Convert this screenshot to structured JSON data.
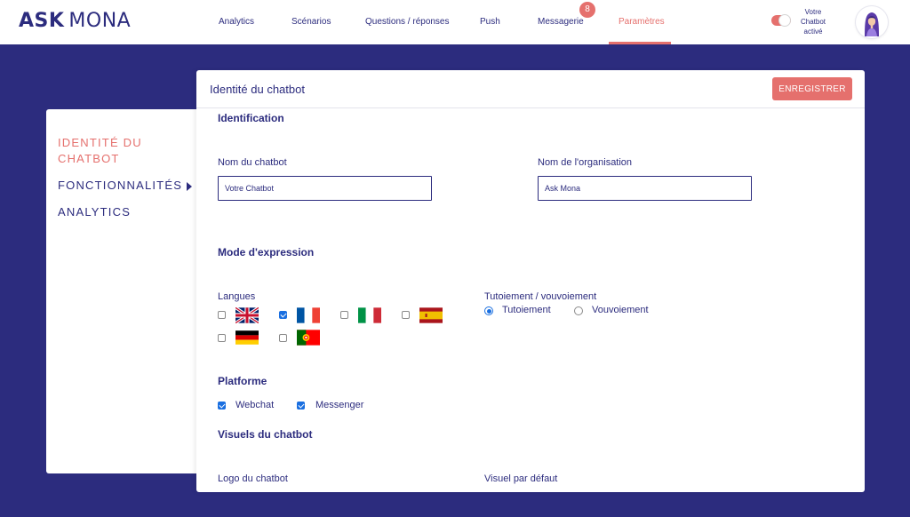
{
  "brand": {
    "logo_ask": "ASK",
    "logo_mona": "MONA"
  },
  "nav": {
    "items": [
      {
        "label": "Analytics"
      },
      {
        "label": "Scénarios"
      },
      {
        "label": "Questions / réponses"
      },
      {
        "label": "Push"
      },
      {
        "label": "Messagerie"
      },
      {
        "label": "Paramètres"
      }
    ],
    "active": "Paramètres",
    "messagerie_badge": "8"
  },
  "chatbot_status": {
    "line1": "Votre",
    "line2": "Chatbot",
    "line3": "activé",
    "enabled": true
  },
  "sidebar": {
    "items": [
      {
        "label": "IDENTITÉ DU CHATBOT"
      },
      {
        "label": "FONCTIONNALITÉS"
      },
      {
        "label": "ANALYTICS"
      }
    ]
  },
  "card": {
    "title": "Identité du chatbot",
    "save_label": "ENREGISTRER"
  },
  "identification": {
    "title": "Identification",
    "chatbot_name_label": "Nom du chatbot",
    "chatbot_name_value": "Votre Chatbot",
    "org_name_label": "Nom de l'organisation",
    "org_name_value": "Ask Mona"
  },
  "expression": {
    "title": "Mode d'expression",
    "languages_label": "Langues",
    "languages": [
      {
        "code": "en",
        "checked": false
      },
      {
        "code": "fr",
        "checked": true
      },
      {
        "code": "it",
        "checked": false
      },
      {
        "code": "es",
        "checked": false
      },
      {
        "code": "de",
        "checked": false
      },
      {
        "code": "pt",
        "checked": false
      }
    ],
    "address_label": "Tutoiement / vouvoiement",
    "tutoiement_label": "Tutoiement",
    "vouvoiement_label": "Vouvoiement",
    "selected": "Tutoiement"
  },
  "platform": {
    "title": "Platforme",
    "webchat_label": "Webchat",
    "webchat_checked": true,
    "messenger_label": "Messenger",
    "messenger_checked": true
  },
  "visuals": {
    "title": "Visuels du chatbot",
    "logo_label": "Logo du chatbot",
    "default_visual_label": "Visuel par défaut"
  },
  "colors": {
    "navy": "#2c2c7e",
    "accent": "#e5706d",
    "checkbox_blue": "#1a6fe0"
  }
}
